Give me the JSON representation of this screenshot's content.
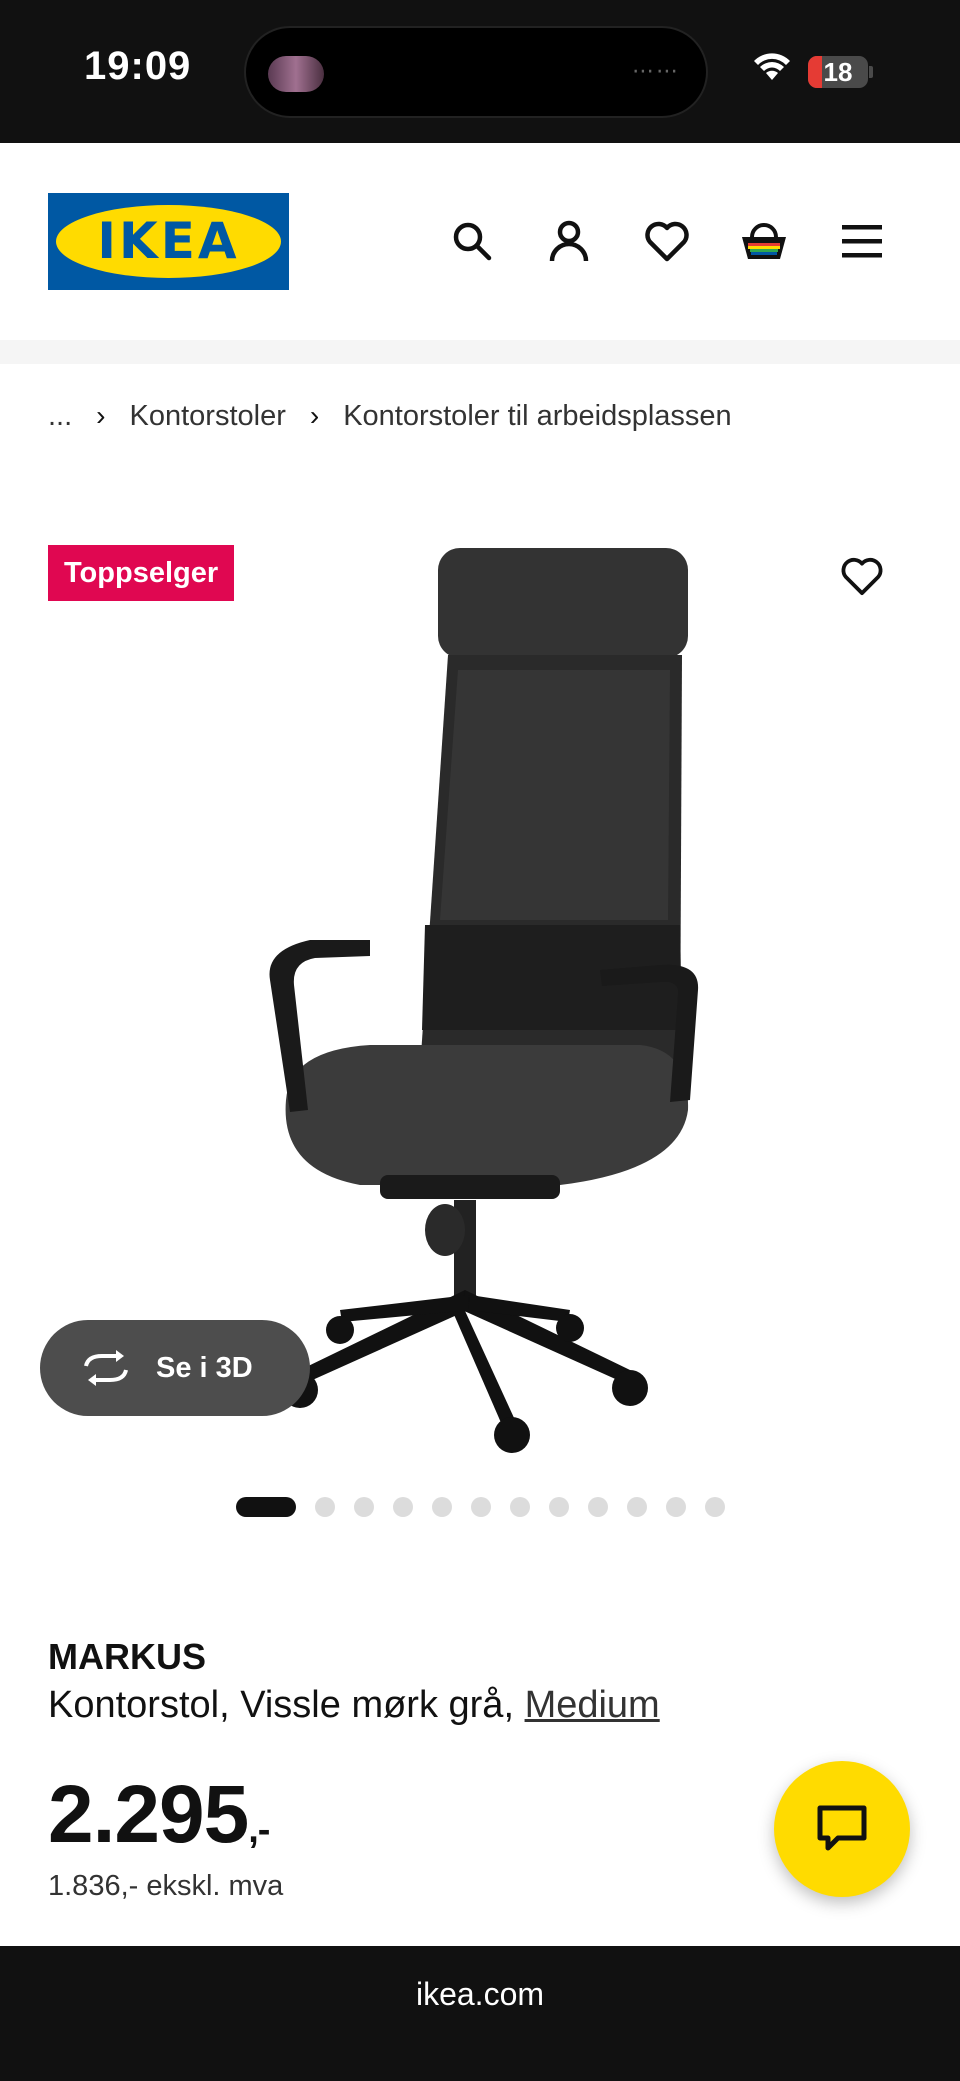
{
  "status_bar": {
    "time": "19:09",
    "battery": "18"
  },
  "header": {
    "logo_text": "IKEA"
  },
  "breadcrumb": {
    "ellipsis": "...",
    "items": [
      "Kontorstoler",
      "Kontorstoler til arbeidsplassen"
    ]
  },
  "gallery": {
    "badge": "Toppselger",
    "view_3d_label": "Se i 3D",
    "image_count": 13,
    "active_index": 0
  },
  "product": {
    "name": "MARKUS",
    "description": "Kontorstol, Vissle mørk grå, ",
    "size_link": "Medium",
    "price_main": "2.295",
    "price_suffix": ",-",
    "price_ex_vat": "1.836,- ekskl. mva"
  },
  "browser": {
    "url": "ikea.com"
  },
  "colors": {
    "brand_blue": "#0058a3",
    "brand_yellow": "#ffdb00",
    "badge": "#e00751"
  }
}
